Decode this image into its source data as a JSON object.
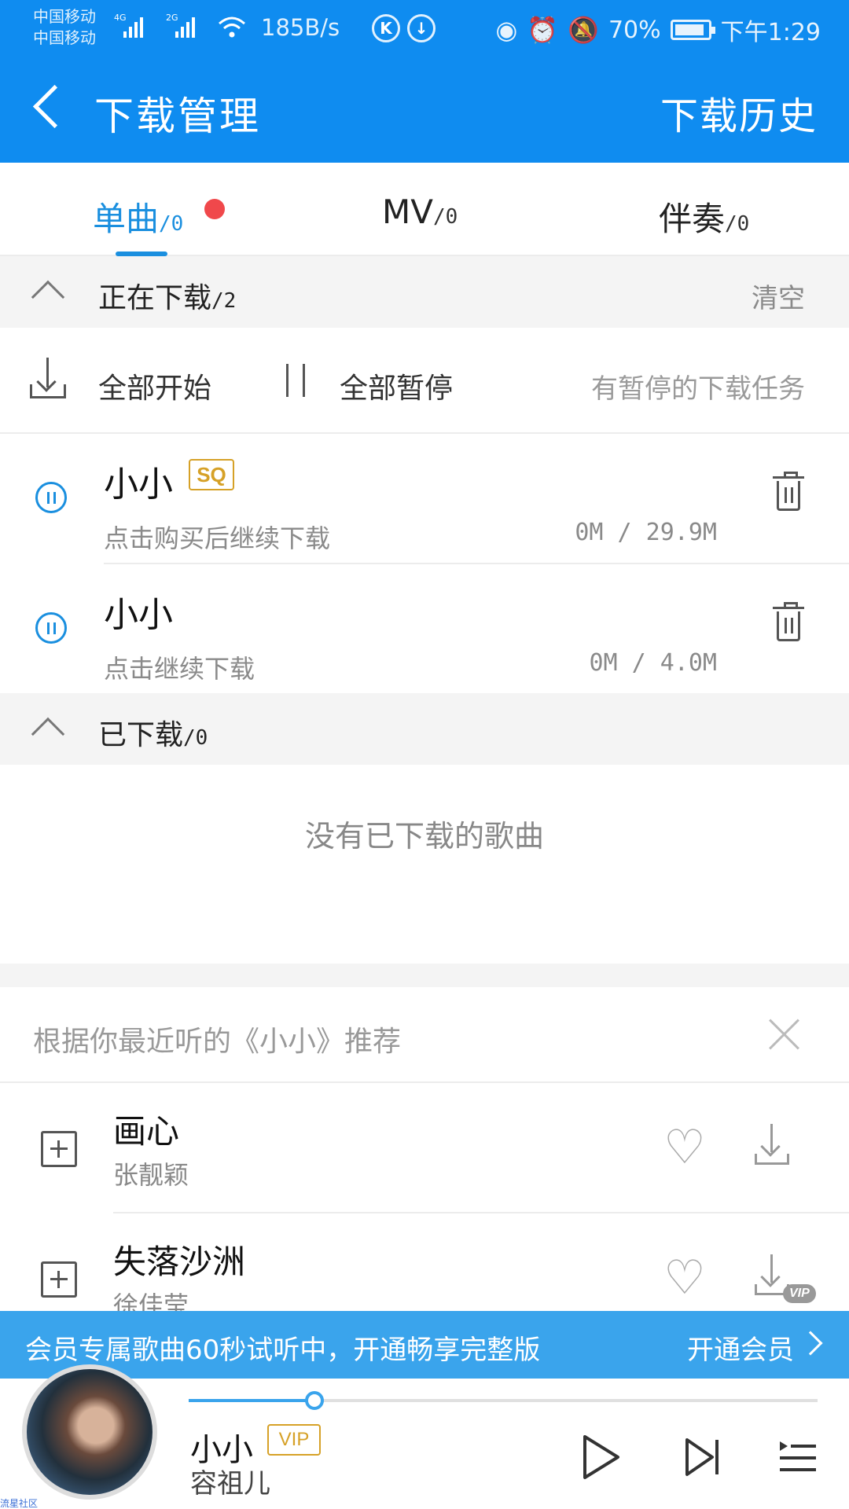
{
  "status_bar": {
    "carrier1": "中国移动",
    "carrier2": "中国移动",
    "net1": "4G",
    "net2": "2G",
    "speed": "185B/s",
    "battery": "70%",
    "time": "下午1:29"
  },
  "header": {
    "title": "下载管理",
    "history_label": "下载历史",
    "background": "#0f8cf0"
  },
  "tabs": [
    {
      "label": "单曲",
      "count": "/0",
      "active": true,
      "has_dot": true
    },
    {
      "label": "MV",
      "count": "/0",
      "active": false
    },
    {
      "label": "伴奏",
      "count": "/0",
      "active": false
    }
  ],
  "downloading": {
    "title": "正在下载",
    "count": "/2",
    "clear_label": "清空",
    "start_all": "全部开始",
    "pause_all": "全部暂停",
    "note": "有暂停的下载任务",
    "items": [
      {
        "name": "小小",
        "badge": "SQ",
        "status": "点击购买后继续下载",
        "size": "0M / 29.9M"
      },
      {
        "name": "小小",
        "status": "点击继续下载",
        "size": "0M / 4.0M"
      }
    ]
  },
  "downloaded": {
    "title": "已下载",
    "count": "/0",
    "empty_message": "没有已下载的歌曲"
  },
  "recommendations": {
    "title": "根据你最近听的《小小》推荐",
    "items": [
      {
        "name": "画心",
        "artist": "张靓颖"
      },
      {
        "name": "失落沙洲",
        "artist": "徐佳莹",
        "vip": "VIP"
      }
    ]
  },
  "vip_banner": {
    "message": "会员专属歌曲60秒试听中，开通畅享完整版",
    "cta": "开通会员"
  },
  "player": {
    "title": "小小",
    "badge": "VIP",
    "artist": "容祖儿",
    "progress": 0.2,
    "watermark": "流星社区",
    "accent": "#3aa4ec"
  },
  "colors": {
    "accent_blue": "#1a8fdf",
    "badge_gold": "#d6a127",
    "dot_red": "#f0484b"
  }
}
